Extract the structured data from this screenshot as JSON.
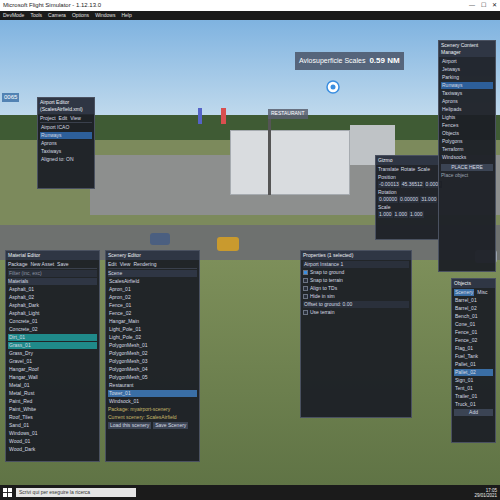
{
  "window": {
    "title": "Microsoft Flight Simulator - 1.12.13.0",
    "controls": [
      "—",
      "☐",
      "✕"
    ]
  },
  "menu": [
    {
      "label": "DevMode",
      "selected": false
    },
    {
      "label": "Tools",
      "selected": false
    },
    {
      "label": "Camera",
      "selected": false
    },
    {
      "label": "Options",
      "selected": false
    },
    {
      "label": "Windows",
      "selected": false
    },
    {
      "label": "Help",
      "selected": false
    }
  ],
  "scene_labels": {
    "airport": "Aviosuperficie Scales",
    "distance": "0.59 NM",
    "restaurant": "RESTAURANT",
    "left": "0065"
  },
  "airport_editor": {
    "title": "Airport Editor (ScalesAirfield.xml)",
    "menu": [
      "Project",
      "Edit",
      "View"
    ],
    "rows": [
      {
        "text": "Airport ICAO",
        "selected": false
      },
      {
        "text": "Runways",
        "selected": true
      },
      {
        "text": "Aprons",
        "selected": false
      },
      {
        "text": "Taxiways",
        "selected": false
      },
      {
        "text": "Aligned to: ON",
        "selected": false
      }
    ]
  },
  "transform": {
    "title": "Gizmo",
    "header": [
      "Translate",
      "Rotate",
      "Scale"
    ],
    "rows": [
      {
        "label": "Position",
        "values": [
          "-0.00013",
          "45.36512",
          "0.0000"
        ]
      },
      {
        "label": "Rotation",
        "values": [
          "0.00000",
          "0.00000",
          "31.000"
        ]
      },
      {
        "label": "Scale",
        "values": [
          "1.000",
          "1.000",
          "1.000"
        ]
      }
    ]
  },
  "content_manager": {
    "title": "Scenery Content Manager",
    "items": [
      {
        "text": "Airport",
        "selected": false
      },
      {
        "text": "Jetways",
        "selected": false
      },
      {
        "text": "Parking",
        "selected": false
      },
      {
        "text": "Runways",
        "selected": true
      },
      {
        "text": "Taxiways",
        "selected": false
      },
      {
        "text": "Aprons",
        "selected": false
      },
      {
        "text": "Helipads",
        "selected": false
      },
      {
        "text": "Lights",
        "selected": false
      },
      {
        "text": "Fences",
        "selected": false
      },
      {
        "text": "Objects",
        "selected": false
      },
      {
        "text": "Polygons",
        "selected": false
      },
      {
        "text": "Terraform",
        "selected": false
      },
      {
        "text": "Windsocks",
        "selected": false
      }
    ],
    "button": "PLACE HERE",
    "footer": "Place object"
  },
  "material_editor": {
    "title": "Material Editor",
    "menu": [
      "Package",
      "New Asset",
      "Save"
    ],
    "filter": "Filter (inc, exc)",
    "section": "Materials",
    "items": [
      {
        "text": "Asphalt_01",
        "selected": false
      },
      {
        "text": "Asphalt_02",
        "selected": false
      },
      {
        "text": "Asphalt_Dark",
        "selected": false
      },
      {
        "text": "Asphalt_Light",
        "selected": false
      },
      {
        "text": "Concrete_01",
        "selected": false
      },
      {
        "text": "Concrete_02",
        "selected": false
      },
      {
        "text": "Dirt_01",
        "selected": true
      },
      {
        "text": "Grass_01",
        "selected": true
      },
      {
        "text": "Grass_Dry",
        "selected": false
      },
      {
        "text": "Gravel_01",
        "selected": false
      },
      {
        "text": "Hangar_Roof",
        "selected": false
      },
      {
        "text": "Hangar_Wall",
        "selected": false
      },
      {
        "text": "Metal_01",
        "selected": false
      },
      {
        "text": "Metal_Rust",
        "selected": false
      },
      {
        "text": "Paint_Red",
        "selected": false
      },
      {
        "text": "Paint_White",
        "selected": false
      },
      {
        "text": "Roof_Tiles",
        "selected": false
      },
      {
        "text": "Sand_01",
        "selected": false
      },
      {
        "text": "Windows_01",
        "selected": false
      },
      {
        "text": "Wood_01",
        "selected": false
      },
      {
        "text": "Wood_Dark",
        "selected": false
      }
    ]
  },
  "scenery_editor": {
    "title": "Scenery Editor",
    "menu": [
      "Edit",
      "View",
      "Rendering"
    ],
    "section": "Scene",
    "items": [
      {
        "text": "ScalesAirfield",
        "selected": false
      },
      {
        "text": "Apron_01",
        "selected": false
      },
      {
        "text": "Apron_02",
        "selected": false
      },
      {
        "text": "Fence_01",
        "selected": false
      },
      {
        "text": "Fence_02",
        "selected": false
      },
      {
        "text": "Hangar_Main",
        "selected": false
      },
      {
        "text": "Light_Pole_01",
        "selected": false
      },
      {
        "text": "Light_Pole_02",
        "selected": false
      },
      {
        "text": "PolygonMesh_01",
        "selected": false
      },
      {
        "text": "PolygonMesh_02",
        "selected": false
      },
      {
        "text": "PolygonMesh_03",
        "selected": false
      },
      {
        "text": "PolygonMesh_04",
        "selected": false
      },
      {
        "text": "PolygonMesh_05",
        "selected": false
      },
      {
        "text": "Restaurant",
        "selected": false
      },
      {
        "text": "Tower_01",
        "selected": true
      },
      {
        "text": "Windsock_01",
        "selected": false
      }
    ],
    "footer": [
      "Package: myairport-scenery",
      "Current scenery: ScalesAirfield"
    ],
    "buttons": [
      "Load this scenery",
      "Save Scenery"
    ]
  },
  "properties": {
    "title": "Properties (1 selected)",
    "rows": [
      {
        "kind": "field",
        "label": "Airport Instance 1",
        "checked": false
      },
      {
        "kind": "check",
        "label": "Snap to ground",
        "checked": true
      },
      {
        "kind": "check",
        "label": "Snap to terrain",
        "checked": false
      },
      {
        "kind": "check",
        "label": "Align to TDs",
        "checked": false
      },
      {
        "kind": "check",
        "label": "Hide in sim",
        "checked": false
      },
      {
        "kind": "field",
        "label": "Offset to ground: 0.00",
        "checked": false
      },
      {
        "kind": "check",
        "label": "Use terrain",
        "checked": false
      }
    ]
  },
  "objects": {
    "title": "Objects",
    "tabs": [
      {
        "label": "Scenery",
        "selected": true
      },
      {
        "label": "Misc",
        "selected": false
      }
    ],
    "items": [
      {
        "text": "Barrel_01",
        "selected": false
      },
      {
        "text": "Barrel_02",
        "selected": false
      },
      {
        "text": "Bench_01",
        "selected": false
      },
      {
        "text": "Cone_01",
        "selected": false
      },
      {
        "text": "Fence_01",
        "selected": false
      },
      {
        "text": "Fence_02",
        "selected": false
      },
      {
        "text": "Flag_01",
        "selected": false
      },
      {
        "text": "Fuel_Tank",
        "selected": false
      },
      {
        "text": "Pallet_01",
        "selected": false
      },
      {
        "text": "Pallet_02",
        "selected": true
      },
      {
        "text": "Sign_01",
        "selected": false
      },
      {
        "text": "Tent_01",
        "selected": false
      },
      {
        "text": "Trailer_01",
        "selected": false
      },
      {
        "text": "Truck_01",
        "selected": false
      }
    ],
    "button": "Add"
  },
  "taskbar": {
    "search": "Scrivi qui per eseguire la ricerca",
    "time": "17:05",
    "date": "29/01/2021"
  }
}
